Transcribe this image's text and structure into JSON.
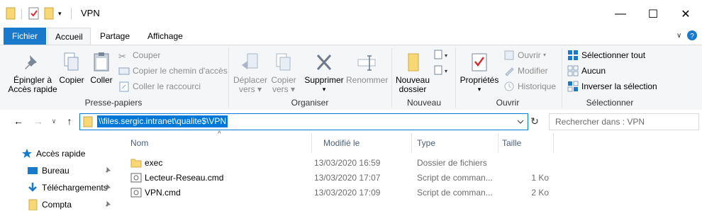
{
  "window": {
    "title": "VPN",
    "controls": {
      "minimize": "—",
      "maximize": "☐",
      "close": "✕"
    }
  },
  "tabs": [
    {
      "label": "Fichier"
    },
    {
      "label": "Accueil"
    },
    {
      "label": "Partage"
    },
    {
      "label": "Affichage"
    }
  ],
  "ribbon": {
    "pin": "Épingler à\nAccès rapide",
    "pin_l1": "Épingler à",
    "pin_l2": "Accès rapide",
    "copy": "Copier",
    "paste": "Coller",
    "cut": "Couper",
    "copy_path": "Copier le chemin d'accès",
    "paste_shortcut": "Coller le raccourci",
    "group_clipboard": "Presse-papiers",
    "move_l1": "Déplacer",
    "move_l2": "vers",
    "copyto_l1": "Copier",
    "copyto_l2": "vers",
    "delete": "Supprimer",
    "rename": "Renommer",
    "group_organize": "Organiser",
    "new_folder_l1": "Nouveau",
    "new_folder_l2": "dossier",
    "group_new": "Nouveau",
    "properties": "Propriétés",
    "open": "Ouvrir",
    "edit": "Modifier",
    "history": "Historique",
    "group_open": "Ouvrir",
    "select_all": "Sélectionner tout",
    "select_none": "Aucun",
    "invert": "Inverser la sélection",
    "group_select": "Sélectionner"
  },
  "address": {
    "path": "\\\\files.sergic.intranet\\qualite$\\VPN",
    "search_placeholder": "Rechercher dans : VPN"
  },
  "nav": [
    {
      "label": "Accès rapide"
    },
    {
      "label": "Bureau"
    },
    {
      "label": "Téléchargements"
    },
    {
      "label": "Compta"
    }
  ],
  "columns": {
    "name": "Nom",
    "modified": "Modifié le",
    "type": "Type",
    "size": "Taille"
  },
  "files": [
    {
      "name": "exec",
      "modified": "13/03/2020 16:59",
      "type": "Dossier de fichiers",
      "size": ""
    },
    {
      "name": "Lecteur-Reseau.cmd",
      "modified": "13/03/2020 17:07",
      "type": "Script de comman...",
      "size": "1 Ko"
    },
    {
      "name": "VPN.cmd",
      "modified": "13/03/2020 17:09",
      "type": "Script de comman...",
      "size": "2 Ko"
    }
  ],
  "colors": {
    "accent": "#0078d7",
    "file_tab": "#1979ca",
    "folder": "#f8d775"
  }
}
